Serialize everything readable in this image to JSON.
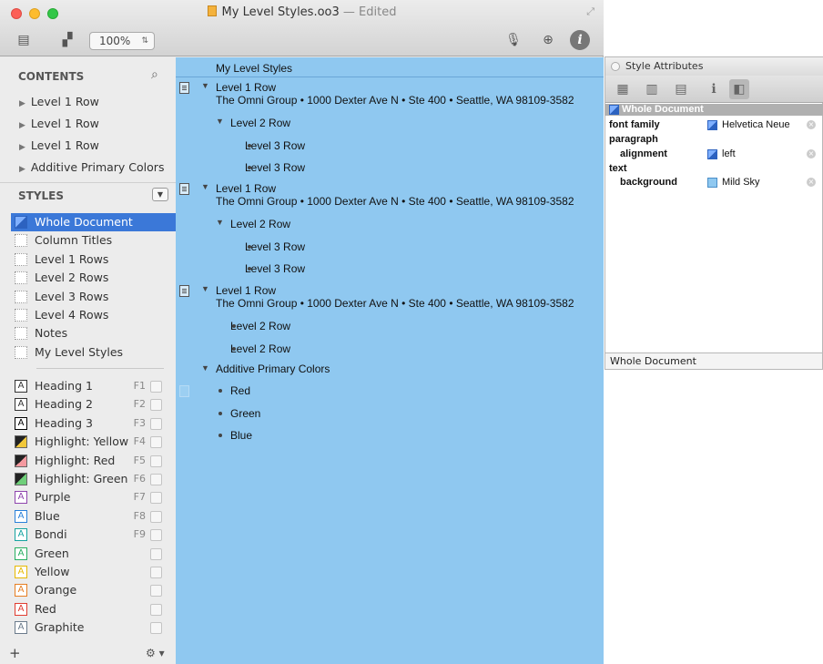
{
  "window": {
    "title": "My Level Styles.oo3",
    "edited_suffix": " — Edited",
    "zoom": "100%"
  },
  "sidebar": {
    "contents_label": "CONTENTS",
    "contents_items": [
      "Level 1 Row",
      "Level 1 Row",
      "Level 1 Row",
      "Additive Primary Colors"
    ],
    "styles_label": "STYLES",
    "styles": [
      "Whole Document",
      "Column Titles",
      "Level 1 Rows",
      "Level 2 Rows",
      "Level 3 Rows",
      "Level 4 Rows",
      "Notes",
      "My Level Styles"
    ],
    "named_styles": [
      {
        "label": "Heading 1",
        "key": "F1",
        "glyph": "A",
        "color": "#333333"
      },
      {
        "label": "Heading 2",
        "key": "F2",
        "glyph": "A",
        "color": "#333333"
      },
      {
        "label": "Heading 3",
        "key": "F3",
        "glyph": "A",
        "color": "#000000"
      },
      {
        "label": "Highlight: Yellow",
        "key": "F4",
        "glyph": "",
        "color": "#f2c83a"
      },
      {
        "label": "Highlight: Red",
        "key": "F5",
        "glyph": "",
        "color": "#f59aa0"
      },
      {
        "label": "Highlight: Green",
        "key": "F6",
        "glyph": "",
        "color": "#6fcf7a"
      },
      {
        "label": "Purple",
        "key": "F7",
        "glyph": "A",
        "color": "#8e44ad"
      },
      {
        "label": "Blue",
        "key": "F8",
        "glyph": "A",
        "color": "#2980d9"
      },
      {
        "label": "Bondi",
        "key": "F9",
        "glyph": "A",
        "color": "#16a3a0"
      },
      {
        "label": "Green",
        "key": "",
        "glyph": "A",
        "color": "#27ae60"
      },
      {
        "label": "Yellow",
        "key": "",
        "glyph": "A",
        "color": "#e6b800"
      },
      {
        "label": "Orange",
        "key": "",
        "glyph": "A",
        "color": "#e67e22"
      },
      {
        "label": "Red",
        "key": "",
        "glyph": "A",
        "color": "#e03c31"
      },
      {
        "label": "Graphite",
        "key": "",
        "glyph": "A",
        "color": "#6b7b8c"
      }
    ],
    "add_label": "+",
    "gear_label": "⚙ ▾"
  },
  "outline": {
    "column_title": "My Level Styles",
    "address": "The Omni Group • 1000 Dexter Ave N • Ste 400 • Seattle, WA 98109-3582",
    "level1": "Level 1 Row",
    "level2": "Level 2 Row",
    "level3": "Level 3 Row",
    "additive": "Additive Primary Colors",
    "colors": [
      "Red",
      "Green",
      "Blue"
    ]
  },
  "panel": {
    "title": "Style Attributes",
    "selected": "Whole Document",
    "font_family_label": "font family",
    "font_family_value": "Helvetica Neue",
    "paragraph_label": "paragraph",
    "alignment_label": "alignment",
    "alignment_value": "left",
    "text_label": "text",
    "background_label": "background",
    "background_value": "Mild Sky",
    "footer": "Whole Document"
  },
  "colors": {
    "outline_background": "#8fc8f0",
    "selection": "#3b78d8"
  }
}
